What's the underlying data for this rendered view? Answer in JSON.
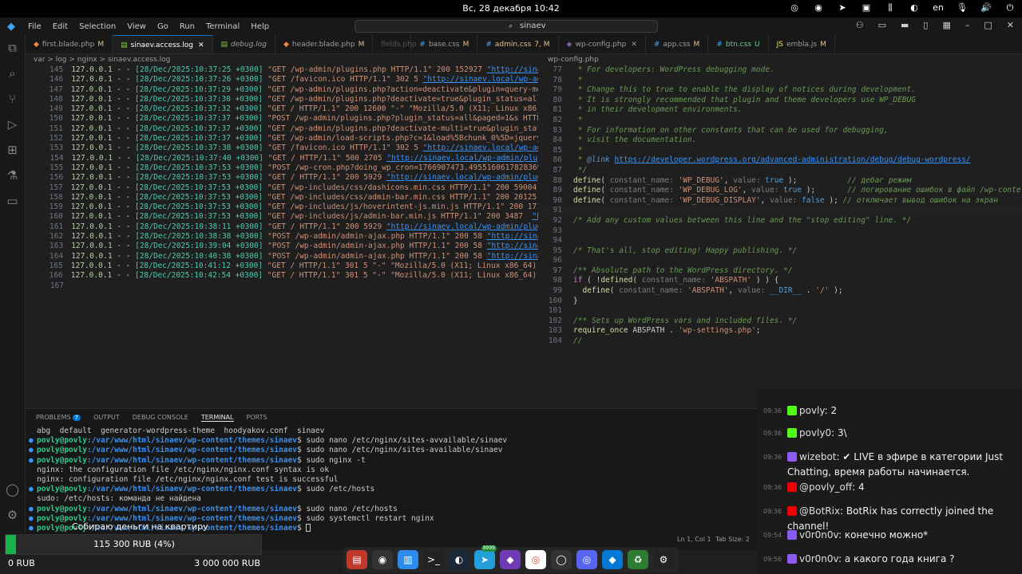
{
  "topbar": {
    "clock": "Вс, 28 декабря 10:42",
    "lang": "en"
  },
  "menubar": {
    "items": [
      "File",
      "Edit",
      "Selection",
      "View",
      "Go",
      "Run",
      "Terminal",
      "Help"
    ],
    "search": "sinaev"
  },
  "tabs": [
    {
      "label": "first.blade.php",
      "mark": "M",
      "active": false
    },
    {
      "label": "sinaev.access.log",
      "mark": "",
      "active": true
    },
    {
      "label": "debug.log",
      "mark": "",
      "active": false
    },
    {
      "label": "header.blade.php",
      "mark": "M",
      "active": false
    },
    {
      "label": "fields.php",
      "mark": "",
      "active": false
    },
    {
      "label": "base.css",
      "mark": "M",
      "active": false
    },
    {
      "label": "admin.css",
      "mark": "7, M",
      "active": false
    },
    {
      "label": "wp-config.php",
      "mark": "",
      "active": false
    },
    {
      "label": "app.css",
      "mark": "M",
      "active": false
    },
    {
      "label": "btn.css",
      "mark": "U",
      "active": false
    },
    {
      "label": "embla.js",
      "mark": "M",
      "active": false
    }
  ],
  "left_breadcrumb": "var > log > nginx > sinaev.access.log",
  "right_breadcrumb": "wp-config.php",
  "log_lines": [
    {
      "n": "145",
      "ip": "127.0.0.1",
      "ts": "[28/Dec/2025:10:37:25 +0300]",
      "req": "\"GET /wp-admin/plugins.php HTTP/1.1\" 200 152927",
      "url": "\"http://sinae"
    },
    {
      "n": "146",
      "ip": "127.0.0.1",
      "ts": "[28/Dec/2025:10:37:26 +0300]",
      "req": "\"GET /favicon.ico HTTP/1.1\" 302 5",
      "url": "\"http://sinaev.local/wp-adm"
    },
    {
      "n": "147",
      "ip": "127.0.0.1",
      "ts": "[28/Dec/2025:10:37:29 +0300]",
      "req": "\"GET /wp-admin/plugins.php?action=deactivate&plugin=query-mon",
      "url": ""
    },
    {
      "n": "148",
      "ip": "127.0.0.1",
      "ts": "[28/Dec/2025:10:37:30 +0300]",
      "req": "\"GET /wp-admin/plugins.php?deactivate=true&plugin_status=all&",
      "url": ""
    },
    {
      "n": "149",
      "ip": "127.0.0.1",
      "ts": "[28/Dec/2025:10:37:32 +0300]",
      "req": "\"GET / HTTP/1.1\" 200 12600 \"-\" \"Mozilla/5.0 (X11; Linux x86_6",
      "url": ""
    },
    {
      "n": "150",
      "ip": "127.0.0.1",
      "ts": "[28/Dec/2025:10:37:37 +0300]",
      "req": "\"POST /wp-admin/plugins.php?plugin_status=all&paged=1&s HTTP/",
      "url": ""
    },
    {
      "n": "151",
      "ip": "127.0.0.1",
      "ts": "[28/Dec/2025:10:37:37 +0300]",
      "req": "\"GET /wp-admin/plugins.php?deactivate-multi=true&plugin_statu",
      "url": ""
    },
    {
      "n": "152",
      "ip": "127.0.0.1",
      "ts": "[28/Dec/2025:10:37:37 +0300]",
      "req": "\"GET /wp-admin/load-scripts.php?c=1&load%5Bchunk_0%5D=jquery-",
      "url": ""
    },
    {
      "n": "153",
      "ip": "127.0.0.1",
      "ts": "[28/Dec/2025:10:37:38 +0300]",
      "req": "\"GET /favicon.ico HTTP/1.1\" 302 5",
      "url": "\"http://sinaev.local/wp-adm"
    },
    {
      "n": "154",
      "ip": "127.0.0.1",
      "ts": "[28/Dec/2025:10:37:40 +0300]",
      "req": "\"GET / HTTP/1.1\" 500 2705",
      "url": "\"http://sinaev.local/wp-admin/plug"
    },
    {
      "n": "155",
      "ip": "127.0.0.1",
      "ts": "[28/Dec/2025:10:37:53 +0300]",
      "req": "\"POST /wp-cron.php?doing_wp_cron=1766907473.4955160617828369",
      "url": ""
    },
    {
      "n": "156",
      "ip": "127.0.0.1",
      "ts": "[28/Dec/2025:10:37:53 +0300]",
      "req": "\"GET / HTTP/1.1\" 200 5929",
      "url": "\"http://sinaev.local/wp-admin/plugi"
    },
    {
      "n": "157",
      "ip": "127.0.0.1",
      "ts": "[28/Dec/2025:10:37:53 +0300]",
      "req": "\"GET /wp-includes/css/dashicons.min.css HTTP/1.1\" 200 59004 \"",
      "url": ""
    },
    {
      "n": "158",
      "ip": "127.0.0.1",
      "ts": "[28/Dec/2025:10:37:53 +0300]",
      "req": "\"GET /wp-includes/css/admin-bar.min.css HTTP/1.1\" 200 20125 \"",
      "url": ""
    },
    {
      "n": "159",
      "ip": "127.0.0.1",
      "ts": "[28/Dec/2025:10:37:53 +0300]",
      "req": "\"GET /wp-includes/js/hoverintent-js.min.js HTTP/1.1\" 200 1718",
      "url": ""
    },
    {
      "n": "160",
      "ip": "127.0.0.1",
      "ts": "[28/Dec/2025:10:37:53 +0300]",
      "req": "\"GET /wp-includes/js/admin-bar.min.js HTTP/1.1\" 200 3487 ",
      "url": "\"htt"
    },
    {
      "n": "161",
      "ip": "127.0.0.1",
      "ts": "[28/Dec/2025:10:38:11 +0300]",
      "req": "\"GET / HTTP/1.1\" 200 5929",
      "url": "\"http://sinaev.local/wp-admin/plugi"
    },
    {
      "n": "162",
      "ip": "127.0.0.1",
      "ts": "[28/Dec/2025:10:38:38 +0300]",
      "req": "\"POST /wp-admin/admin-ajax.php HTTP/1.1\" 200 58",
      "url": "\"http://sinae"
    },
    {
      "n": "163",
      "ip": "127.0.0.1",
      "ts": "[28/Dec/2025:10:39:04 +0300]",
      "req": "\"POST /wp-admin/admin-ajax.php HTTP/1.1\" 200 58",
      "url": "\"http://sinae"
    },
    {
      "n": "164",
      "ip": "127.0.0.1",
      "ts": "[28/Dec/2025:10:40:38 +0300]",
      "req": "\"POST /wp-admin/admin-ajax.php HTTP/1.1\" 200 58",
      "url": "\"http://sinae"
    },
    {
      "n": "165",
      "ip": "127.0.0.1",
      "ts": "[28/Dec/2025:10:41:12 +0300]",
      "req": "\"GET / HTTP/1.1\" 301 5 \"-\" \"Mozilla/5.0 (X11; Linux x86_64) A",
      "url": ""
    },
    {
      "n": "166",
      "ip": "127.0.0.1",
      "ts": "[28/Dec/2025:10:42:54 +0300]",
      "req": "\"GET / HTTP/1.1\" 301 5 \"-\" \"Mozilla/5.0 (X11; Linux x86_64) A",
      "url": ""
    },
    {
      "n": "167",
      "ip": "",
      "ts": "",
      "req": "",
      "url": ""
    }
  ],
  "code_lines": [
    {
      "n": "77",
      "segs": [
        {
          "c": "cm",
          "t": " * For developers: WordPress debugging mode."
        }
      ]
    },
    {
      "n": "78",
      "segs": [
        {
          "c": "cm",
          "t": " *"
        }
      ]
    },
    {
      "n": "79",
      "segs": [
        {
          "c": "cm",
          "t": " * Change this to true to enable the display of notices during development."
        }
      ]
    },
    {
      "n": "80",
      "segs": [
        {
          "c": "cm",
          "t": " * It is strongly recommended that plugin and theme developers use WP_DEBUG"
        }
      ]
    },
    {
      "n": "81",
      "segs": [
        {
          "c": "cm",
          "t": " * in their development environments."
        }
      ]
    },
    {
      "n": "82",
      "segs": [
        {
          "c": "cm",
          "t": " *"
        }
      ]
    },
    {
      "n": "83",
      "segs": [
        {
          "c": "cm",
          "t": " * For information on other constants that can be used for debugging,"
        }
      ]
    },
    {
      "n": "84",
      "segs": [
        {
          "c": "cm",
          "t": " * visit the documentation."
        }
      ]
    },
    {
      "n": "85",
      "segs": [
        {
          "c": "cm",
          "t": " *"
        }
      ]
    },
    {
      "n": "86",
      "segs": [
        {
          "c": "cm",
          "t": " * "
        },
        {
          "c": "tag",
          "t": "@link"
        },
        {
          "c": "cm",
          "t": " "
        },
        {
          "c": "lnk",
          "t": "https://developer.wordpress.org/advanced-administration/debug/debug-wordpress/"
        }
      ]
    },
    {
      "n": "87",
      "segs": [
        {
          "c": "cm",
          "t": " */"
        }
      ]
    },
    {
      "n": "88",
      "segs": [
        {
          "c": "fn",
          "t": "define"
        },
        {
          "c": "",
          "t": "( "
        },
        {
          "c": "hint",
          "t": "constant_name: "
        },
        {
          "c": "str",
          "t": "'WP_DEBUG'"
        },
        {
          "c": "",
          "t": ", "
        },
        {
          "c": "hint",
          "t": "value: "
        },
        {
          "c": "kw",
          "t": "true"
        },
        {
          "c": "",
          "t": " );           "
        },
        {
          "c": "cm",
          "t": "// дебаг режим"
        }
      ]
    },
    {
      "n": "89",
      "segs": [
        {
          "c": "fn",
          "t": "define"
        },
        {
          "c": "",
          "t": "( "
        },
        {
          "c": "hint",
          "t": "constant_name: "
        },
        {
          "c": "str",
          "t": "'WP_DEBUG_LOG'"
        },
        {
          "c": "",
          "t": ", "
        },
        {
          "c": "hint",
          "t": "value: "
        },
        {
          "c": "kw",
          "t": "true"
        },
        {
          "c": "",
          "t": " );       "
        },
        {
          "c": "cm",
          "t": "// логирование ошибок в файл /wp-conte"
        }
      ]
    },
    {
      "n": "90",
      "segs": [
        {
          "c": "fn",
          "t": "define"
        },
        {
          "c": "",
          "t": "( "
        },
        {
          "c": "hint",
          "t": "constant_name: "
        },
        {
          "c": "str",
          "t": "'WP_DEBUG_DISPLAY'"
        },
        {
          "c": "",
          "t": ", "
        },
        {
          "c": "hint",
          "t": "value: "
        },
        {
          "c": "kw",
          "t": "false"
        },
        {
          "c": "",
          "t": " ); "
        },
        {
          "c": "cm",
          "t": "// отключает вывод ошибок на экран"
        }
      ]
    },
    {
      "n": "91",
      "segs": [
        {
          "c": "",
          "t": ""
        }
      ]
    },
    {
      "n": "92",
      "segs": [
        {
          "c": "cm",
          "t": "/* Add any custom values between this line and the \"stop editing\" line. */"
        }
      ]
    },
    {
      "n": "93",
      "segs": [
        {
          "c": "",
          "t": ""
        }
      ]
    },
    {
      "n": "94",
      "segs": [
        {
          "c": "",
          "t": ""
        }
      ]
    },
    {
      "n": "95",
      "segs": [
        {
          "c": "cm",
          "t": "/* That's all, stop editing! Happy publishing. */"
        }
      ]
    },
    {
      "n": "96",
      "segs": [
        {
          "c": "",
          "t": ""
        }
      ]
    },
    {
      "n": "97",
      "segs": [
        {
          "c": "cm",
          "t": "/** Absolute path to the WordPress directory. */"
        }
      ]
    },
    {
      "n": "98",
      "segs": [
        {
          "c": "ctl",
          "t": "if"
        },
        {
          "c": "",
          "t": " ( !"
        },
        {
          "c": "fn",
          "t": "defined"
        },
        {
          "c": "",
          "t": "( "
        },
        {
          "c": "hint",
          "t": "constant_name: "
        },
        {
          "c": "str",
          "t": "'ABSPATH'"
        },
        {
          "c": "",
          "t": " ) ) {"
        }
      ]
    },
    {
      "n": "99",
      "segs": [
        {
          "c": "",
          "t": "  "
        },
        {
          "c": "fn",
          "t": "define"
        },
        {
          "c": "",
          "t": "( "
        },
        {
          "c": "hint",
          "t": "constant_name: "
        },
        {
          "c": "str",
          "t": "'ABSPATH'"
        },
        {
          "c": "",
          "t": ", "
        },
        {
          "c": "hint",
          "t": "value: "
        },
        {
          "c": "kw",
          "t": "__DIR__"
        },
        {
          "c": "",
          "t": " . "
        },
        {
          "c": "str",
          "t": "'/'"
        },
        {
          "c": "",
          "t": " );"
        }
      ]
    },
    {
      "n": "100",
      "segs": [
        {
          "c": "",
          "t": "}"
        }
      ]
    },
    {
      "n": "101",
      "segs": [
        {
          "c": "",
          "t": ""
        }
      ]
    },
    {
      "n": "102",
      "segs": [
        {
          "c": "cm",
          "t": "/** Sets up WordPress vars and included files. */"
        }
      ]
    },
    {
      "n": "103",
      "segs": [
        {
          "c": "fn",
          "t": "require_once"
        },
        {
          "c": "",
          "t": " ABSPATH . "
        },
        {
          "c": "str",
          "t": "'wp-settings.php'"
        },
        {
          "c": "",
          "t": ";"
        }
      ]
    },
    {
      "n": "104",
      "segs": [
        {
          "c": "cm",
          "t": "//"
        }
      ]
    }
  ],
  "panel": {
    "tabs": [
      "PROBLEMS",
      "OUTPUT",
      "DEBUG CONSOLE",
      "TERMINAL",
      "PORTS"
    ],
    "problems_count": "7",
    "active": "TERMINAL"
  },
  "terminal": [
    {
      "kind": "out",
      "text": "abg  default  generator-wordpress-theme  hoodyakov.conf  sinaev"
    },
    {
      "kind": "cmd",
      "cmd": "sudo nano /etc/nginx/sites-avvailable/sinaev"
    },
    {
      "kind": "cmd",
      "cmd": "sudo nano /etc/nginx/sites-available/sinaev"
    },
    {
      "kind": "cmd",
      "cmd": "sudo nginx -t"
    },
    {
      "kind": "out",
      "text": "nginx: the configuration file /etc/nginx/nginx.conf syntax is ok"
    },
    {
      "kind": "out",
      "text": "nginx: configuration file /etc/nginx/nginx.conf test is successful"
    },
    {
      "kind": "cmd",
      "cmd": "sudo /etc/hosts"
    },
    {
      "kind": "out",
      "text": "sudo: /etc/hosts: команда не найдена"
    },
    {
      "kind": "cmd",
      "cmd": "sudo nano /etc/hosts"
    },
    {
      "kind": "cmd",
      "cmd": "sudo systemctl restart nginx"
    },
    {
      "kind": "cmd",
      "cmd": ""
    }
  ],
  "prompt": {
    "user": "povly@povly",
    "path": ":/var/www/html/sinaev/wp-content/themes/sinaev",
    "sign": "$ "
  },
  "statusbar": {
    "position": "Ln 1, Col 1",
    "tabsize": "Tab Size: 2"
  },
  "chat": [
    {
      "time": "09:36",
      "platform": "kick",
      "user": "povly",
      "text": "2"
    },
    {
      "time": "09:36",
      "platform": "kick",
      "user": "povly0",
      "text": "3\\"
    },
    {
      "time": "09:36",
      "platform": "twitch",
      "user": "wizebot",
      "text": "✔ LIVE в эфире в категории Just Chatting, время работы начинается."
    },
    {
      "time": "09:36",
      "platform": "youtube",
      "user": "@povly_off",
      "text": "4"
    },
    {
      "time": "09:36",
      "platform": "youtube",
      "user": "@BotRix",
      "text": "BotRix has correctly joined the channel!"
    },
    {
      "time": "09:54",
      "platform": "twitch",
      "user": "v0r0n0v",
      "text": "конечно можно*"
    },
    {
      "time": "09:56",
      "platform": "twitch",
      "user": "v0r0n0v",
      "text": "а какого года книга ?"
    }
  ],
  "goal": {
    "title": "Собираю деньги на квартиру",
    "progress_text": "115 300 RUB (4%)",
    "progress_fraction": 0.04,
    "min": "0 RUB",
    "max": "3 000 000 RUB"
  },
  "dock": {
    "steam_badge": "9999"
  }
}
